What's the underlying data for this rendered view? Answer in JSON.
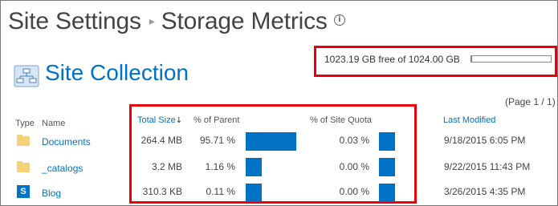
{
  "breadcrumb": {
    "parent": "Site Settings",
    "current": "Storage Metrics",
    "separator_icon": "chevron-right-icon",
    "info_icon": "info-icon"
  },
  "site_collection": {
    "title": "Site Collection",
    "icon": "site-hierarchy-icon"
  },
  "storage": {
    "text": "1023.19 GB free of 1024.00 GB",
    "used_fraction": 0.0008
  },
  "pagination": "(Page 1 / 1)",
  "columns": {
    "type": "Type",
    "name": "Name",
    "total_size": "Total Size",
    "sort_icon": "sort-descending-icon",
    "pct_parent": "% of Parent",
    "pct_quota": "% of Site Quota",
    "last_modified": "Last Modified"
  },
  "rows": [
    {
      "icon": "folder-icon",
      "name": "Documents",
      "total_size": "264.4 MB",
      "pct_parent": "95.71 %",
      "pct_parent_value": 95.71,
      "pct_quota": "0.03 %",
      "pct_quota_value": 0.03,
      "last_modified": "9/18/2015 6:05 PM"
    },
    {
      "icon": "folder-icon",
      "name": "_catalogs",
      "total_size": "3.2 MB",
      "pct_parent": "1.16 %",
      "pct_parent_value": 1.16,
      "pct_quota": "0.00 %",
      "pct_quota_value": 0.0,
      "last_modified": "9/22/2015 11:43 PM"
    },
    {
      "icon": "sharepoint-icon",
      "name": "Blog",
      "total_size": "310.3 KB",
      "pct_parent": "0.11 %",
      "pct_parent_value": 0.11,
      "pct_quota": "0.00 %",
      "pct_quota_value": 0.0,
      "last_modified": "3/26/2015 4:35 PM"
    }
  ],
  "sp_icon_letter": "S",
  "colors": {
    "accent": "#0072c6",
    "highlight_box": "#e8000b",
    "storage_fill": "#5a8a5a",
    "folder": "#f5d27a"
  }
}
